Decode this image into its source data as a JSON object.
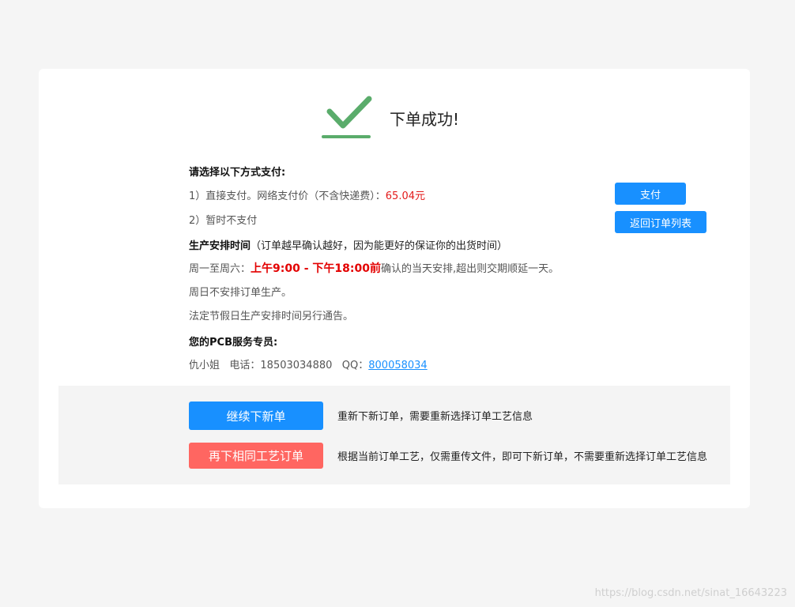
{
  "header": {
    "title": "下单成功!"
  },
  "payment": {
    "heading": "请选择以下方式支付:",
    "option1_text": "1）直接支付。网络支付价（不含快递费）：",
    "option1_price": "65.04元",
    "option2_text": "2）暂时不支付",
    "pay_button": "支付",
    "return_button": "返回订单列表"
  },
  "schedule": {
    "heading_bold": "生产安排时间",
    "heading_note": "（订单越早确认越好，因为能更好的保证你的出货时间）",
    "weekday_prefix": "周一至周六：",
    "weekday_time": "上午9:00 - 下午18:00前",
    "weekday_suffix": "确认的当天安排,超出则交期顺延一天。",
    "sunday": "周日不安排订单生产。",
    "holiday": "法定节假日生产安排时间另行通告。"
  },
  "service": {
    "heading": "您的PCB服务专员:",
    "contact_text": "仇小姐   电话：18503034880   QQ：",
    "qq": "800058034"
  },
  "actions": {
    "continue_button": "继续下新单",
    "continue_desc": "重新下新订单，需要重新选择订单工艺信息",
    "same_button": "再下相同工艺订单",
    "same_desc": "根据当前订单工艺，仅需重传文件，即可下新订单，不需要重新选择订单工艺信息"
  },
  "watermark": "https://blog.csdn.net/sinat_16643223",
  "colors": {
    "accent_blue": "#1890ff",
    "accent_red": "#ff6661",
    "price_red": "#e31b1b",
    "check_green": "#5aac6b"
  }
}
